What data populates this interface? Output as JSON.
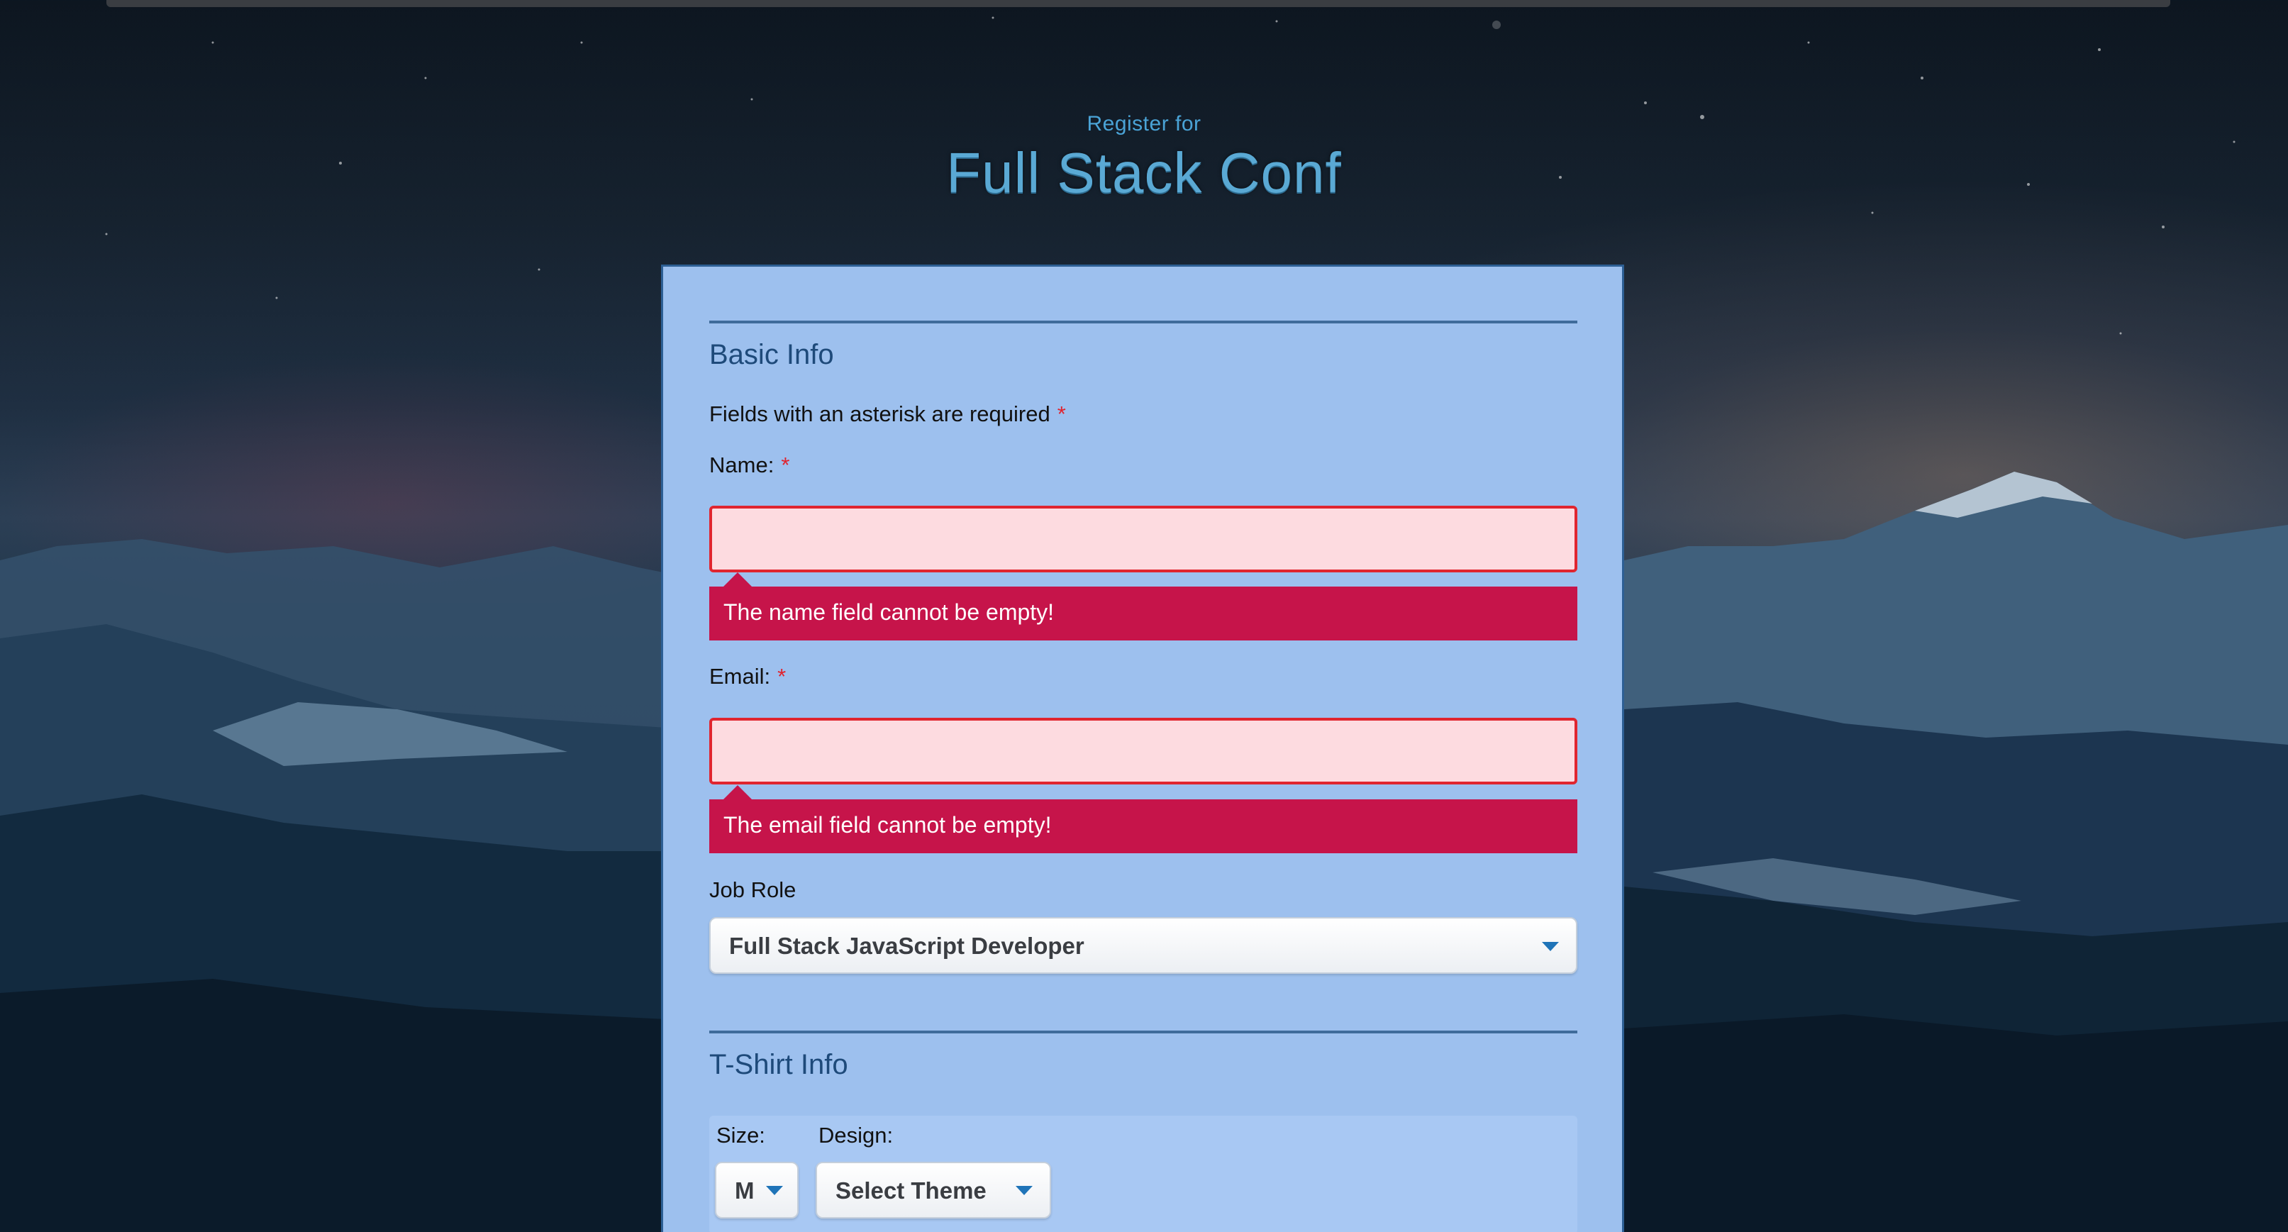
{
  "header": {
    "register_for": "Register for",
    "title": "Full Stack Conf"
  },
  "basic_info": {
    "heading": "Basic Info",
    "required_note": "Fields with an asterisk are required",
    "asterisk": "*",
    "name": {
      "label": "Name:",
      "value": "",
      "error": "The name field cannot be empty!"
    },
    "email": {
      "label": "Email:",
      "value": "",
      "error": "The email field cannot be empty!"
    },
    "job_role": {
      "label": "Job Role",
      "selected": "Full Stack JavaScript Developer"
    }
  },
  "tshirt_info": {
    "heading": "T-Shirt Info",
    "size_label": "Size:",
    "size_selected": "M",
    "design_label": "Design:",
    "design_selected": "Select Theme"
  },
  "colors": {
    "card_background": "#9dc0ee",
    "error_red": "#c6144a",
    "input_error_border": "#e0252f",
    "input_error_fill": "#fddbe0",
    "heading_blue": "#1e4a7a",
    "title_blue": "#5aa9d4"
  },
  "icons": {
    "select_caret": "caret-down-icon"
  }
}
